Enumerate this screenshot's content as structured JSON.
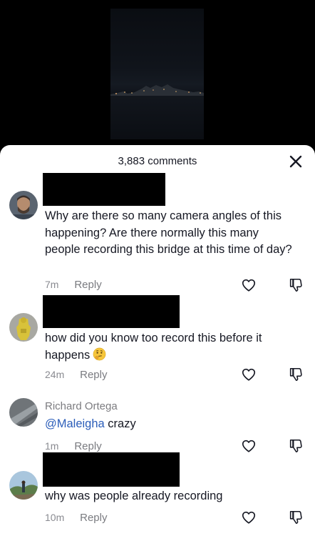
{
  "sheet": {
    "comment_count": "3,883 comments"
  },
  "comments": [
    {
      "username": "",
      "text": "Why are there so many camera angles of this happening? Are there normally this many people recording this bridge at this time of day?",
      "time": "7m",
      "reply_label": "Reply"
    },
    {
      "username": "",
      "text": "how did you know too record this before it happens",
      "emoji": "thinking-face-emoji",
      "time": "24m",
      "reply_label": "Reply"
    },
    {
      "username": "Richard Ortega",
      "mention": "@Maleigha",
      "text": " crazy",
      "time": "1m",
      "reply_label": "Reply"
    },
    {
      "username": "",
      "text": "why was people already recording",
      "time": "10m",
      "reply_label": "Reply"
    }
  ],
  "icons": {
    "close": "close-icon",
    "like": "heart-outline-icon",
    "dislike": "thumbs-down-icon"
  },
  "colors": {
    "sheet_bg": "#ffffff",
    "text": "#161823",
    "muted": "#8a8b91",
    "mention": "#2b5db9",
    "redaction": "#000000"
  }
}
